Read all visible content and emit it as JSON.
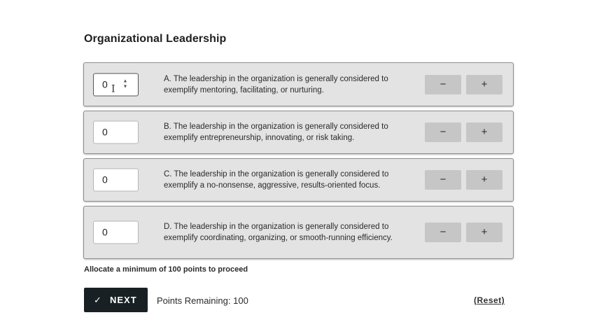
{
  "page": {
    "title": "Organizational Leadership"
  },
  "items": [
    {
      "value": "0",
      "text": "A. The leadership in the organization is generally considered to exemplify mentoring, facilitating, or nurturing.",
      "minus": "−",
      "plus": "+"
    },
    {
      "value": "0",
      "text": "B. The leadership in the organization is generally considered to exemplify entrepreneurship, innovating, or risk taking.",
      "minus": "−",
      "plus": "+"
    },
    {
      "value": "0",
      "text": "C. The leadership in the organization is generally considered to exemplify a no-nonsense, aggressive, results-oriented focus.",
      "minus": "−",
      "plus": "+"
    },
    {
      "value": "0",
      "text": "D. The leadership in the organization is generally considered to exemplify coordinating, organizing, or smooth-running efficiency.",
      "minus": "−",
      "plus": "+"
    }
  ],
  "hint": "Allocate a minimum of 100 points to proceed",
  "footer": {
    "next_icon": "✓",
    "next_label": "NEXT",
    "remaining": "Points Remaining: 100",
    "reset": "(Reset)"
  }
}
